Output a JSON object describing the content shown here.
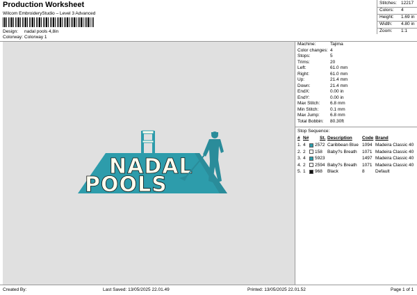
{
  "header": {
    "title": "Production Worksheet",
    "subtitle": "Wilcom EmbroideryStudio – Level 3 Advanced",
    "design_label": "Design:",
    "design_value": "nadal pools 4,8in",
    "colorway_label": "Colorway:",
    "colorway_value": "Colorway 1"
  },
  "stats": [
    {
      "label": "Stitches:",
      "value": "12217"
    },
    {
      "label": "Colors:",
      "value": "4"
    },
    {
      "label": "Height:",
      "value": "1.69 in"
    },
    {
      "label": "Width:",
      "value": "4.80 in"
    },
    {
      "label": "Zoom:",
      "value": "1:1"
    }
  ],
  "design": {
    "line1": "NADAL",
    "line2": "POOLS",
    "colors": {
      "teal": "#2d9cab",
      "cream": "#ffffef",
      "black": "#111111",
      "canvas": "#e0e0e0"
    }
  },
  "machine_info": [
    {
      "label": "Machine:",
      "value": "Tajima"
    },
    {
      "label": "Color changes:",
      "value": "4"
    },
    {
      "label": "Stops:",
      "value": "5"
    },
    {
      "label": "Trims:",
      "value": "20"
    },
    {
      "label": "Left:",
      "value": "61.0 mm"
    },
    {
      "label": "Right:",
      "value": "61.0 mm"
    },
    {
      "label": "Up:",
      "value": "21.4 mm"
    },
    {
      "label": "Down:",
      "value": "21.4 mm"
    },
    {
      "label": "EndX:",
      "value": "0.00 in"
    },
    {
      "label": "EndY:",
      "value": "0.00 in"
    },
    {
      "label": "Max Stitch:",
      "value": "6.8 mm"
    },
    {
      "label": "Min Stitch:",
      "value": "0.1 mm"
    },
    {
      "label": "Max Jump:",
      "value": "6.8 mm"
    },
    {
      "label": "Total Bobbin:",
      "value": "80.30ft"
    }
  ],
  "stop_sequence": {
    "title": "Stop Sequence:",
    "headers": [
      "#",
      "N#",
      "St.",
      "Description",
      "Code",
      "Brand"
    ],
    "rows": [
      {
        "num": "1.",
        "n": "4",
        "color": "#2d9cab",
        "st": "2572",
        "desc": "Caribbean Blue",
        "code": "1094",
        "brand": "Madeira Classic 40"
      },
      {
        "num": "2.",
        "n": "2",
        "color": "#ffffff",
        "st": "158",
        "desc": "Baby?s Breath",
        "code": "1071",
        "brand": "Madeira Classic 40"
      },
      {
        "num": "3.",
        "n": "4",
        "color": "#2d9cab",
        "st": "5923",
        "desc": "",
        "code": "1497",
        "brand": "Madeira Classic 40"
      },
      {
        "num": "4.",
        "n": "2",
        "color": "#ffffff",
        "st": "2594",
        "desc": "Baby?s Breath",
        "code": "1071",
        "brand": "Madeira Classic 40"
      },
      {
        "num": "5.",
        "n": "1",
        "color": "#111111",
        "st": "968",
        "desc": "Black",
        "code": "8",
        "brand": "Default"
      }
    ]
  },
  "footer": {
    "created_by": "Created By:",
    "last_saved": "Last Saved: 13/05/2025 22.01.49",
    "printed": "Printed: 13/05/2025 22.01.52",
    "page": "Page 1 of 1"
  }
}
